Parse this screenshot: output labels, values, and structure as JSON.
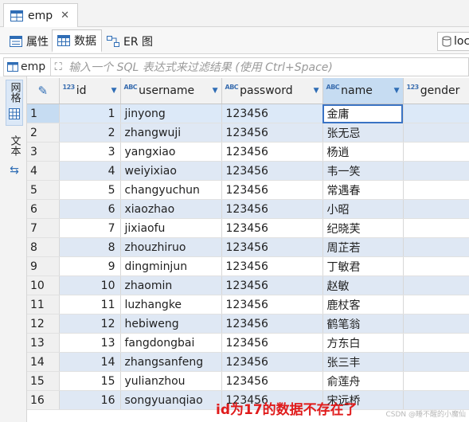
{
  "editor_tab": {
    "label": "emp",
    "close": "✕"
  },
  "sub_tabs": [
    {
      "label": "属性"
    },
    {
      "label": "数据"
    },
    {
      "label": "ER 图"
    }
  ],
  "connection": {
    "label": "loc"
  },
  "filter": {
    "entity": "emp",
    "placeholder": "输入一个 SQL 表达式来过滤结果 (使用 Ctrl+Space)"
  },
  "side_toolbar": {
    "grid_label": "网格",
    "text_label": "文本"
  },
  "columns": [
    {
      "type": "123",
      "name": "id"
    },
    {
      "type": "ABC",
      "name": "username"
    },
    {
      "type": "ABC",
      "name": "password"
    },
    {
      "type": "ABC",
      "name": "name"
    },
    {
      "type": "123",
      "name": "gender"
    }
  ],
  "rows": [
    {
      "rn": "1",
      "id": "1",
      "username": "jinyong",
      "password": "123456",
      "name": "金庸",
      "gender": ""
    },
    {
      "rn": "2",
      "id": "2",
      "username": "zhangwuji",
      "password": "123456",
      "name": "张无忌",
      "gender": ""
    },
    {
      "rn": "3",
      "id": "3",
      "username": "yangxiao",
      "password": "123456",
      "name": "杨逍",
      "gender": ""
    },
    {
      "rn": "4",
      "id": "4",
      "username": "weiyixiao",
      "password": "123456",
      "name": "韦一笑",
      "gender": ""
    },
    {
      "rn": "5",
      "id": "5",
      "username": "changyuchun",
      "password": "123456",
      "name": "常遇春",
      "gender": ""
    },
    {
      "rn": "6",
      "id": "6",
      "username": "xiaozhao",
      "password": "123456",
      "name": "小昭",
      "gender": ""
    },
    {
      "rn": "7",
      "id": "7",
      "username": "jixiaofu",
      "password": "123456",
      "name": "纪晓芙",
      "gender": ""
    },
    {
      "rn": "8",
      "id": "8",
      "username": "zhouzhiruo",
      "password": "123456",
      "name": "周芷若",
      "gender": ""
    },
    {
      "rn": "9",
      "id": "9",
      "username": "dingminjun",
      "password": "123456",
      "name": "丁敏君",
      "gender": ""
    },
    {
      "rn": "10",
      "id": "10",
      "username": "zhaomin",
      "password": "123456",
      "name": "赵敏",
      "gender": ""
    },
    {
      "rn": "11",
      "id": "11",
      "username": "luzhangke",
      "password": "123456",
      "name": "鹿杖客",
      "gender": ""
    },
    {
      "rn": "12",
      "id": "12",
      "username": "hebiweng",
      "password": "123456",
      "name": "鹤笔翁",
      "gender": ""
    },
    {
      "rn": "13",
      "id": "13",
      "username": "fangdongbai",
      "password": "123456",
      "name": "方东白",
      "gender": ""
    },
    {
      "rn": "14",
      "id": "14",
      "username": "zhangsanfeng",
      "password": "123456",
      "name": "张三丰",
      "gender": ""
    },
    {
      "rn": "15",
      "id": "15",
      "username": "yulianzhou",
      "password": "123456",
      "name": "俞莲舟",
      "gender": ""
    },
    {
      "rn": "16",
      "id": "16",
      "username": "songyuanqiao",
      "password": "123456",
      "name": "宋远桥",
      "gender": ""
    }
  ],
  "annotation": "id为17的数据不存在了",
  "watermark": "CSDN @睡不醒的小魔仙",
  "colors": {
    "accent": "#3a73c4",
    "selected_header": "#c6dcf2",
    "stripe": "#dfe8f4",
    "annotation": "#e01b1b"
  }
}
